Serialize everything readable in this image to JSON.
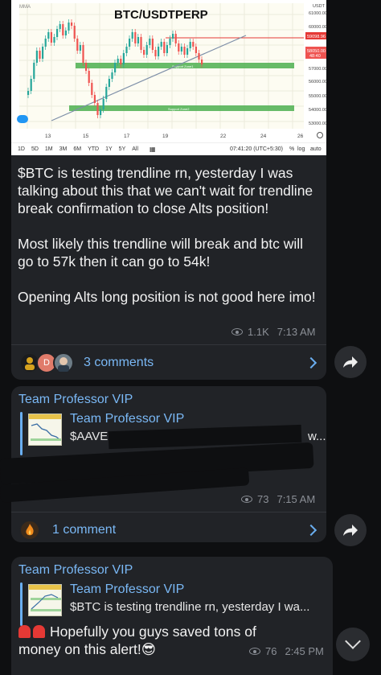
{
  "message1": {
    "chart": {
      "title": "BTC/USDTPERP",
      "watermark": "MMA",
      "axis_unit": "USDT",
      "price_ticks": [
        "61000.00",
        "60000.00",
        "59098.96",
        "58050.00",
        "57000.00",
        "56000.00",
        "55000.00",
        "54000.00",
        "53000.00"
      ],
      "countdown": "48:40",
      "date_ticks": [
        "13",
        "15",
        "17",
        "19",
        "22",
        "24",
        "26"
      ],
      "zone_labels": [
        "Support Zone1",
        "Support Zone2"
      ],
      "timeframes": [
        "1D",
        "5D",
        "1M",
        "3M",
        "6M",
        "YTD",
        "1Y",
        "5Y",
        "All"
      ],
      "clock": "07:41:20 (UTC+5:30)",
      "pct_label": "%",
      "log_label": "log",
      "auto_label": "auto",
      "colors": {
        "trendline": "#7e8fa8",
        "resistance": "#e53935",
        "support": "#4caf50",
        "up": "#26a69a",
        "down": "#ef5350"
      }
    },
    "text": "$BTC is testing trendline rn, yesterday I was talking about this that we can't wait for trendline break confirmation to close Alts position!\n\nMost likely this trendline will break and btc will go to 57k then it can go to 54k!\n\nOpening Alts long position is not good here imo!",
    "views": "1.1K",
    "time": "7:13 AM",
    "comments": "3 comments",
    "avatar_letter": "D"
  },
  "message2": {
    "sender": "Team Professor VIP",
    "reply_name": "Team Professor VIP",
    "reply_text": "$AAVE",
    "reply_tail": "w...",
    "views": "73",
    "time": "7:15 AM",
    "comments": "1 comment"
  },
  "message3": {
    "sender": "Team Professor VIP",
    "reply_name": "Team Professor VIP",
    "reply_text": "$BTC is testing trendline rn, yesterday I wa...",
    "text": "Hopefully you guys saved tons of money on this alert!",
    "emoji": "😎",
    "views": "76",
    "time": "2:45 PM"
  }
}
